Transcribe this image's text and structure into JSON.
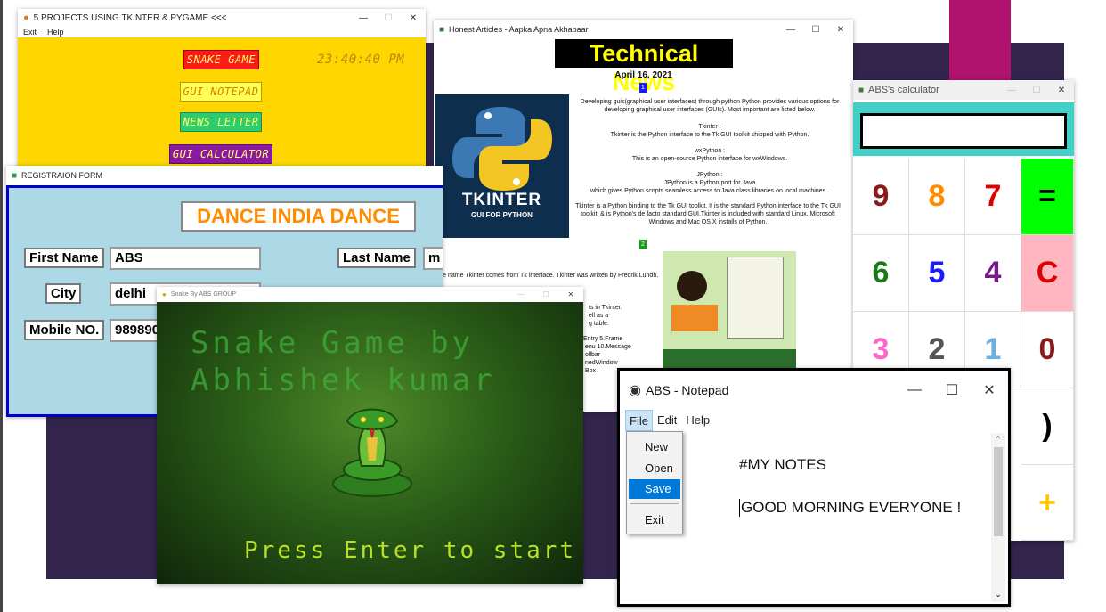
{
  "colors": {
    "purple_panel": "#33244b",
    "magenta_bar": "#b0126e",
    "yellow": "#ffd600",
    "light_blue": "#add8e6",
    "calc_teal": "#40d0c8"
  },
  "projects": {
    "title": "5 PROJECTS USING TKINTER & PYGAME <<<",
    "menu": [
      "Exit",
      "Help"
    ],
    "buttons": {
      "snake": "SNAKE GAME",
      "notepad": "GUI NOTEPAD",
      "news": "NEWS LETTER",
      "calc": "GUI CALCULATOR"
    },
    "clock": "23:40:40 PM"
  },
  "news": {
    "title": "Honest Articles - Aapka Apna Akhabaar",
    "heading": "Technical News",
    "date": "April 16, 2021",
    "badge1": "1",
    "badge2": "2",
    "logo_text": "TKINTER",
    "logo_sub": "GUI FOR PYTHON",
    "intro": "Developing guis(graphical user interfaces) through python Python provides various options for developing graphical user interfaces (GUIs). Most important are listed below.",
    "tk_head": "Tkinter :",
    "tk_body": "Tkinter is the Python interface to the Tk GUI toolkit shipped with Python.",
    "wx_head": "wxPython :",
    "wx_body": "This is an open-source Python interface for wxWindows.",
    "jp_head": "JPython :",
    "jp_body1": "JPython is a Python port for Java",
    "jp_body2": "which gives Python scripts seamless access to Java class libraries on local machines .",
    "tk_para": "Tkinter is a Python binding to the Tk GUI toolkit. It is the standard Python interface to the Tk GUI toolkit, & is Python's de facto standard GUI.Tkinter is included with standard Linux, Microsoft Windows and Mac OS X installs of Python.",
    "name_line": "The name Tkinter comes from Tk interface. Tkinter was written by Fredrik Lundh.",
    "frag1": "ts in Tkinter.",
    "frag2": "ell as a",
    "frag3": "g table.",
    "frag4": "Entry  5.Frame",
    "frag5": "enu  10.Message",
    "frag6": "ollbar",
    "frag7": "nedWindow",
    "frag8": "Box"
  },
  "calc": {
    "title": "ABS's calculator",
    "keys": [
      "9",
      "8",
      "7",
      "=",
      "6",
      "5",
      "4",
      "C",
      "3",
      "2",
      "1",
      "0",
      ")",
      "+"
    ]
  },
  "reg": {
    "title": "REGISTRAION FORM",
    "heading": "DANCE INDIA DANCE",
    "first_name_label": "First Name",
    "first_name_value": "ABS",
    "last_name_label": "Last Name",
    "last_name_value": "m",
    "city_label": "City",
    "city_value": "delhi",
    "mobile_label": "Mobile NO.",
    "mobile_value": "989890"
  },
  "snake": {
    "title": "Snake By ABS GROUP",
    "line1": "Snake Game by",
    "line2": "Abhishek kumar",
    "prompt": "Press Enter to start"
  },
  "notepad": {
    "title": "ABS - Notepad",
    "menu": [
      "File",
      "Edit",
      "Help"
    ],
    "file_menu": [
      "New",
      "Open",
      "Save",
      "Exit"
    ],
    "line1": "#MY NOTES",
    "line2": "GOOD MORNING EVERYONE !"
  }
}
